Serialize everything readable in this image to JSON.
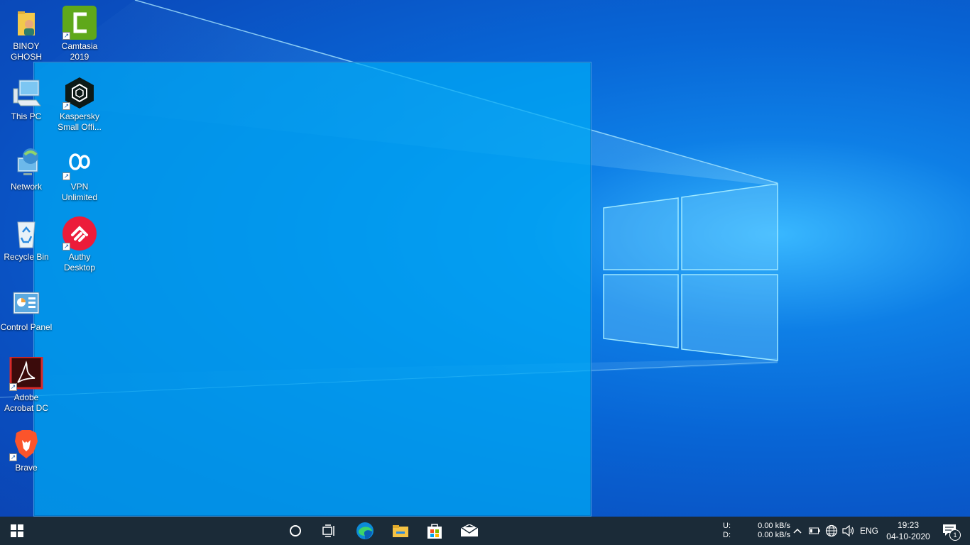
{
  "desktop_icons": [
    {
      "name": "BINOY GHOSH",
      "kind": "user-folder"
    },
    {
      "name": "Camtasia 2019",
      "kind": "app",
      "shortcut": true
    },
    {
      "name": "This PC",
      "kind": "system"
    },
    {
      "name": "Kaspersky Small Offi...",
      "kind": "app",
      "shortcut": true
    },
    {
      "name": "Network",
      "kind": "system"
    },
    {
      "name": "VPN Unlimited",
      "kind": "app",
      "shortcut": true
    },
    {
      "name": "Recycle Bin",
      "kind": "system"
    },
    {
      "name": "Authy Desktop",
      "kind": "app",
      "shortcut": true
    },
    {
      "name": "Control Panel",
      "kind": "system"
    },
    {
      "name": "Adobe Acrobat DC",
      "kind": "app",
      "shortcut": true
    },
    {
      "name": "Brave",
      "kind": "app",
      "shortcut": true
    }
  ],
  "taskbar": {
    "pinned": [
      "search-circle-icon",
      "task-view-icon",
      "edge-icon",
      "file-explorer-icon",
      "store-icon",
      "mail-icon"
    ],
    "net_meter": {
      "up_label": "U:",
      "down_label": "D:",
      "up_value": "0.00 kB/s",
      "down_value": "0.00 kB/s"
    },
    "language": "ENG",
    "time": "19:23",
    "date": "04-10-2020",
    "notification_count": "1"
  },
  "colors": {
    "taskbar_bg": "#1b2b38",
    "desktop_blue": "#0a6ad9",
    "selection_fill": "#00aaf5"
  }
}
